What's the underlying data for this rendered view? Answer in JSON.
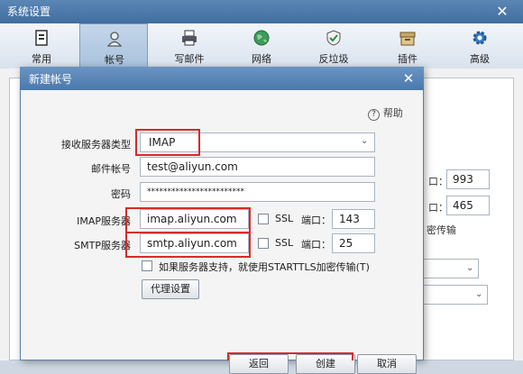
{
  "window": {
    "title": "系统设置"
  },
  "toolbar": {
    "items": [
      {
        "label": "常用",
        "icon": "settings-doc-icon"
      },
      {
        "label": "帐号",
        "icon": "user-icon"
      },
      {
        "label": "写邮件",
        "icon": "printer-icon"
      },
      {
        "label": "网络",
        "icon": "globe-icon"
      },
      {
        "label": "反垃圾",
        "icon": "shield-icon"
      },
      {
        "label": "插件",
        "icon": "box-icon"
      },
      {
        "label": "高级",
        "icon": "gear-icon"
      }
    ],
    "active_index": 1
  },
  "background": {
    "port_imap": "993",
    "port_smtp": "465",
    "frag_kou_1": "口：",
    "frag_kou_2": "口：",
    "frag_chuanshu": "密传输"
  },
  "dialog": {
    "title": "新建帐号",
    "help": "帮助",
    "server_type_label": "接收服务器类型",
    "server_type_value": "IMAP",
    "email_label": "邮件帐号",
    "email_value": "test@aliyun.com",
    "password_label": "密码",
    "password_value": "************************",
    "imap_label": "IMAP服务器",
    "imap_value": "imap.aliyun.com",
    "smtp_label": "SMTP服务器",
    "smtp_value": "smtp.aliyun.com",
    "ssl_label": "SSL",
    "port_label": "端口：",
    "imap_port": "143",
    "smtp_port": "25",
    "starttls_label": "如果服务器支持，就使用STARTTLS加密传输(T)",
    "proxy_button": "代理设置",
    "footer_buttons": [
      "返回",
      "创建",
      "取消"
    ]
  },
  "colors": {
    "highlight": "#d62b2b",
    "titlebar": "#4a79ab"
  }
}
